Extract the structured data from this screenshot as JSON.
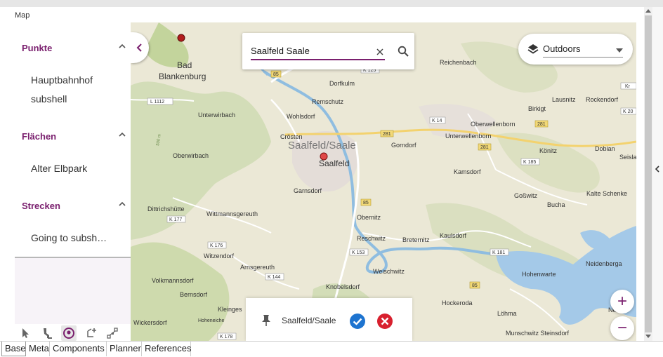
{
  "panel": {
    "title": "Map"
  },
  "sidebar": {
    "sections": [
      {
        "title": "Punkte",
        "items": [
          "Hauptbahnhof",
          "subshell"
        ]
      },
      {
        "title": "Flächen",
        "items": [
          "Alter Elbpark"
        ]
      },
      {
        "title": "Strecken",
        "items": [
          "Going to subsh…"
        ]
      }
    ],
    "tools": [
      "pointer-icon",
      "pin-tool-icon",
      "location-icon",
      "polygon-add-icon",
      "path-nodes-icon"
    ]
  },
  "search": {
    "value": "Saalfeld Saale"
  },
  "layer": {
    "selected": "Outdoors"
  },
  "confirm": {
    "label": "Saalfeld/Saale"
  },
  "zoom": {
    "in": "+",
    "out": "−"
  },
  "map_labels": {
    "bad": "Bad",
    "blankenburg": "Blankenburg",
    "dorfkulm": "Dorfkulm",
    "reichenbach": "Reichenbach",
    "remschutz": "Remschutz",
    "wohlsdorf": "Wohlsdorf",
    "unterwirbach": "Unterwirbach",
    "croesten": "Crösten",
    "saalfeld_big": "Saalfeld/Saale",
    "saalfeld": "Saalfeld",
    "gorndorf": "Gorndorf",
    "unterwellenborn": "Unterwellenborn",
    "oberwellenborn": "Oberwellenborn",
    "birkigt": "Birkigt",
    "lausnitz": "Lausnitz",
    "rockendorf": "Rockendorf",
    "oberwirbach": "Oberwirbach",
    "koenitz": "Könitz",
    "dobian": "Dobian",
    "seisla": "Seisla",
    "kamsdorf": "Kamsdorf",
    "garnsdorf": "Garnsdorf",
    "gosswitz": "Goßwitz",
    "kalte_schenke": "Kalte Schenke",
    "dittrichshuette": "Dittrichshütte",
    "wittmannsgereuth": "Wittmannsgereuth",
    "obernitz": "Obernitz",
    "bucha": "Bucha",
    "reschwitz": "Reschwitz",
    "breternitz": "Breternitz",
    "kaulsdorf": "Kaulsdorf",
    "witzendorf": "Witzendorf",
    "arnsgereuth": "Arnsgereuth",
    "weischwitz": "Weischwitz",
    "hohenwarte": "Hohenwarte",
    "neidenberga": "Neidenberga",
    "volkmannsdorf": "Volkmannsdorf",
    "bernsdorf": "Bernsdorf",
    "knobelsdorf": "Knobelsdorf",
    "hockeroda": "Hockeroda",
    "kleingeschwenda": "Kleinges",
    "wickersdorf": "Wickersdorf",
    "hoheneiche": "Hoheneiche",
    "loehma": "Löhma",
    "munschwitz": "Munschwitz Steinsdorf",
    "elev": "500 m",
    "l1112": "L 1112",
    "k14": "K 14",
    "k125": "K 125",
    "k177": "K 177",
    "k176": "K 176",
    "k153": "K 153",
    "k144": "K 144",
    "k178": "K 178",
    "k181": "K 181",
    "k185": "K 185",
    "k20": "K 20",
    "kr": "Kr",
    "r85a": "85",
    "r85b": "85",
    "r85c": "85",
    "r281a": "281",
    "r281b": "281",
    "r281c": "281",
    "nemd": "Nemd"
  },
  "tabs": [
    "Base",
    "Meta",
    "Components",
    "Planner",
    "References"
  ],
  "colors": {
    "accent": "#7a1f6e",
    "confirm_blue": "#1e74d0",
    "cancel_red": "#d8202e",
    "water": "#a4c9e8",
    "forest": "#c6d6a8"
  }
}
